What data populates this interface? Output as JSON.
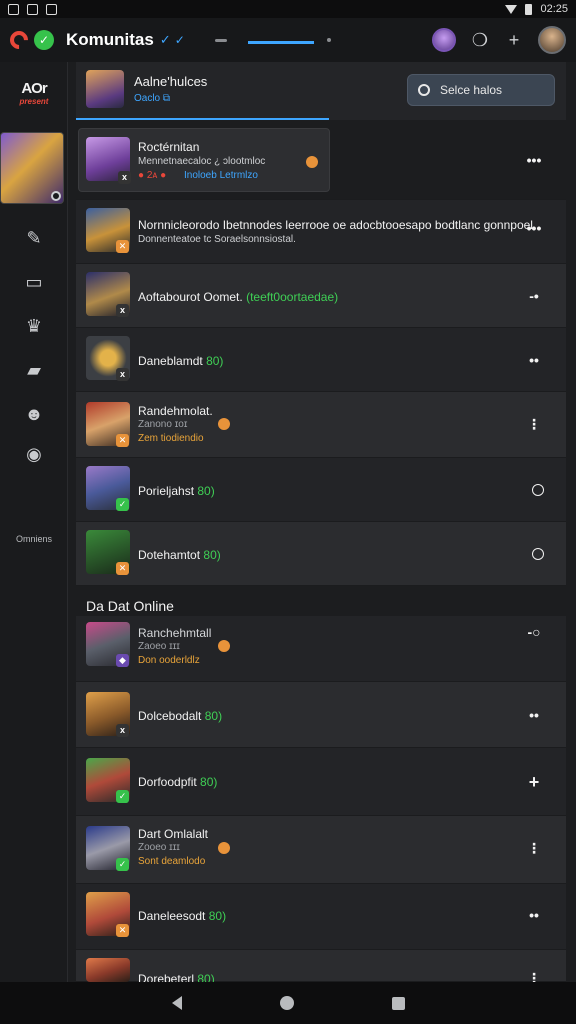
{
  "statusbar": {
    "time": "02:25"
  },
  "topbar": {
    "title": "Komunitas",
    "verify_mark": "✓",
    "verify_mark2": "✓"
  },
  "sidebar": {
    "logo_line1": "AOr",
    "logo_line2": "present",
    "bottom_label": "Omniens"
  },
  "header": {
    "title": "Aalne'hulces",
    "subtitle": "Oaclo ⧉",
    "search_placeholder": "Selce halos"
  },
  "rows": [
    {
      "title": "Roctérnitan",
      "sub1": "Mennetnaecaloc ¿ ɔlootmloc",
      "sub2_red": "● 2ᴀ ●",
      "sub2_blue": "Inoloeb Letrmlzo"
    },
    {
      "title": "Nornnicleorodo Ibetnnodes leerrooe oe ⁠adocb⁠tooesapo bodtlanc gonnpoel.",
      "sub1": "Donnenteatoe tc Soraelsonnsiostal."
    },
    {
      "title": "Aoftabourot Oomet.",
      "title_green": "(teeft0oortaedae)"
    },
    {
      "title": "Daneblamdt",
      "title_green": "80)"
    },
    {
      "title": "Randehmolat.",
      "sub1": "Zanono ɪᴏɪ",
      "sub2": "Zem tiodiendio"
    },
    {
      "title": "Porieljahst",
      "title_green": "80)"
    },
    {
      "title": "Dotehamtot",
      "title_green": "80)"
    }
  ],
  "section_title": "Da Dat Online",
  "rows2": [
    {
      "title": "Ranchehmtall",
      "sub1": "Zaoeo ɪɪɪ",
      "sub2": "Don ooderldlz"
    },
    {
      "title": "Dolcebodalt",
      "title_green": "80)"
    },
    {
      "title": "Dorfoodpfit",
      "title_green": "80)"
    },
    {
      "title": "Dart Omlalalt",
      "sub1": "Zooeo ɪɪɪ",
      "sub2": "Sont deamlodo"
    },
    {
      "title": "Daneleesodt",
      "title_green": "80)"
    },
    {
      "title": "Dorebeterl",
      "title_green": "80)"
    }
  ],
  "actions": [
    "•••",
    "•••",
    "-•",
    "••",
    "⋮",
    "○",
    "○",
    "-○",
    "••",
    "+",
    "⋮",
    "••",
    "⋮"
  ],
  "colors": {
    "accent": "#3ea6ff",
    "online": "#3fcf55",
    "badge_orange": "#e8933a",
    "background": "#1c1d1f"
  }
}
